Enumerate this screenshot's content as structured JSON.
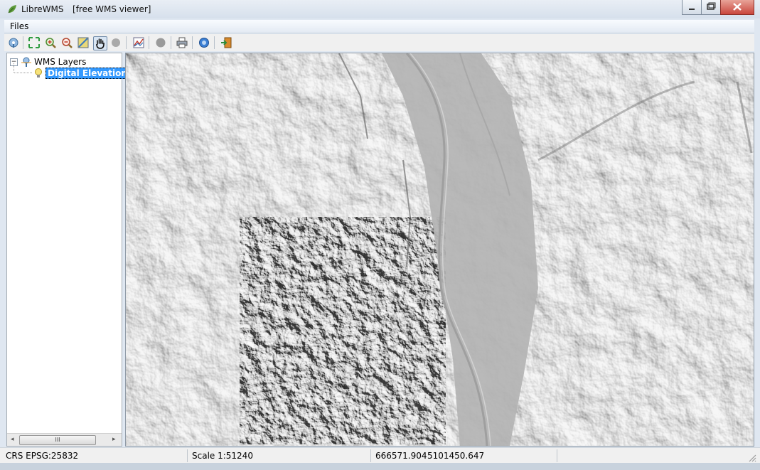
{
  "window": {
    "app_name": "LibreWMS",
    "subtitle": "[free WMS viewer]"
  },
  "menu": {
    "files_label": "Files"
  },
  "toolbar": {
    "buttons": [
      {
        "name": "connect-wms-icon"
      },
      {
        "name": "zoom-extent-icon"
      },
      {
        "name": "zoom-in-icon"
      },
      {
        "name": "zoom-out-icon"
      },
      {
        "name": "layer-info-icon"
      },
      {
        "name": "pan-hand-icon",
        "active": true
      },
      {
        "name": "stop-icon"
      },
      {
        "name": "chart-icon"
      },
      {
        "name": "record-icon"
      },
      {
        "name": "print-icon"
      },
      {
        "name": "help-icon"
      },
      {
        "name": "exit-icon"
      }
    ]
  },
  "layers_panel": {
    "root_label": "WMS Layers",
    "layer_label": "Digital Elevation",
    "scroll_thumb_label": "III"
  },
  "status": {
    "crs": "CRS EPSG:25832",
    "scale": "Scale 1:51240",
    "x_coord": "666571.904",
    "y_coord": "5101450.647"
  },
  "colors": {
    "title_bar": "#dbe4ef",
    "selection": "#3399ff",
    "hillshade": "#b9b9b9",
    "close_button": "#c9463d"
  }
}
